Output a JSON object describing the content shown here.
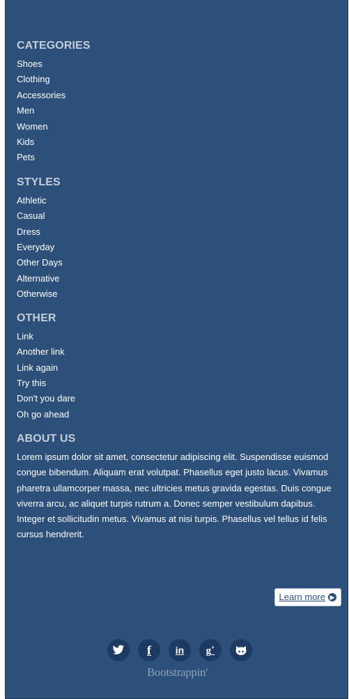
{
  "categories": {
    "title": "CATEGORIES",
    "items": [
      "Shoes",
      "Clothing",
      "Accessories",
      "Men",
      "Women",
      "Kids",
      "Pets"
    ]
  },
  "styles": {
    "title": "STYLES",
    "items": [
      "Athletic",
      "Casual",
      "Dress",
      "Everyday",
      "Other Days",
      "Alternative",
      "Otherwise"
    ]
  },
  "other": {
    "title": "OTHER",
    "items": [
      "Link",
      "Another link",
      "Link again",
      "Try this",
      "Don't you dare",
      "Oh go ahead"
    ]
  },
  "about": {
    "title": "ABOUT US",
    "text": "Lorem ipsum dolor sit amet, consectetur adipiscing elit. Suspendisse euismod congue bibendum. Aliquam erat volutpat. Phasellus eget justo lacus. Vivamus pharetra ullamcorper massa, nec ultricies metus gravida egestas. Duis congue viverra arcu, ac aliquet turpis rutrum a. Donec semper vestibulum dapibus. Integer et sollicitudin metus. Vivamus at nisi turpis. Phasellus vel tellus id felis cursus hendrerit.",
    "learn_more_label": "Learn more"
  },
  "social": [
    {
      "name": "twitter-icon",
      "glyph": "t"
    },
    {
      "name": "facebook-icon",
      "glyph": "f"
    },
    {
      "name": "linkedin-icon",
      "glyph": "in"
    },
    {
      "name": "google-plus-icon",
      "glyph": "g+"
    },
    {
      "name": "github-icon",
      "glyph": "gh"
    }
  ],
  "brand": "Bootstrappin'",
  "colors": {
    "background": "#2d507a",
    "heading": "#c4cdd9",
    "link": "#ffffff",
    "icon_circle": "#1d3b62"
  }
}
